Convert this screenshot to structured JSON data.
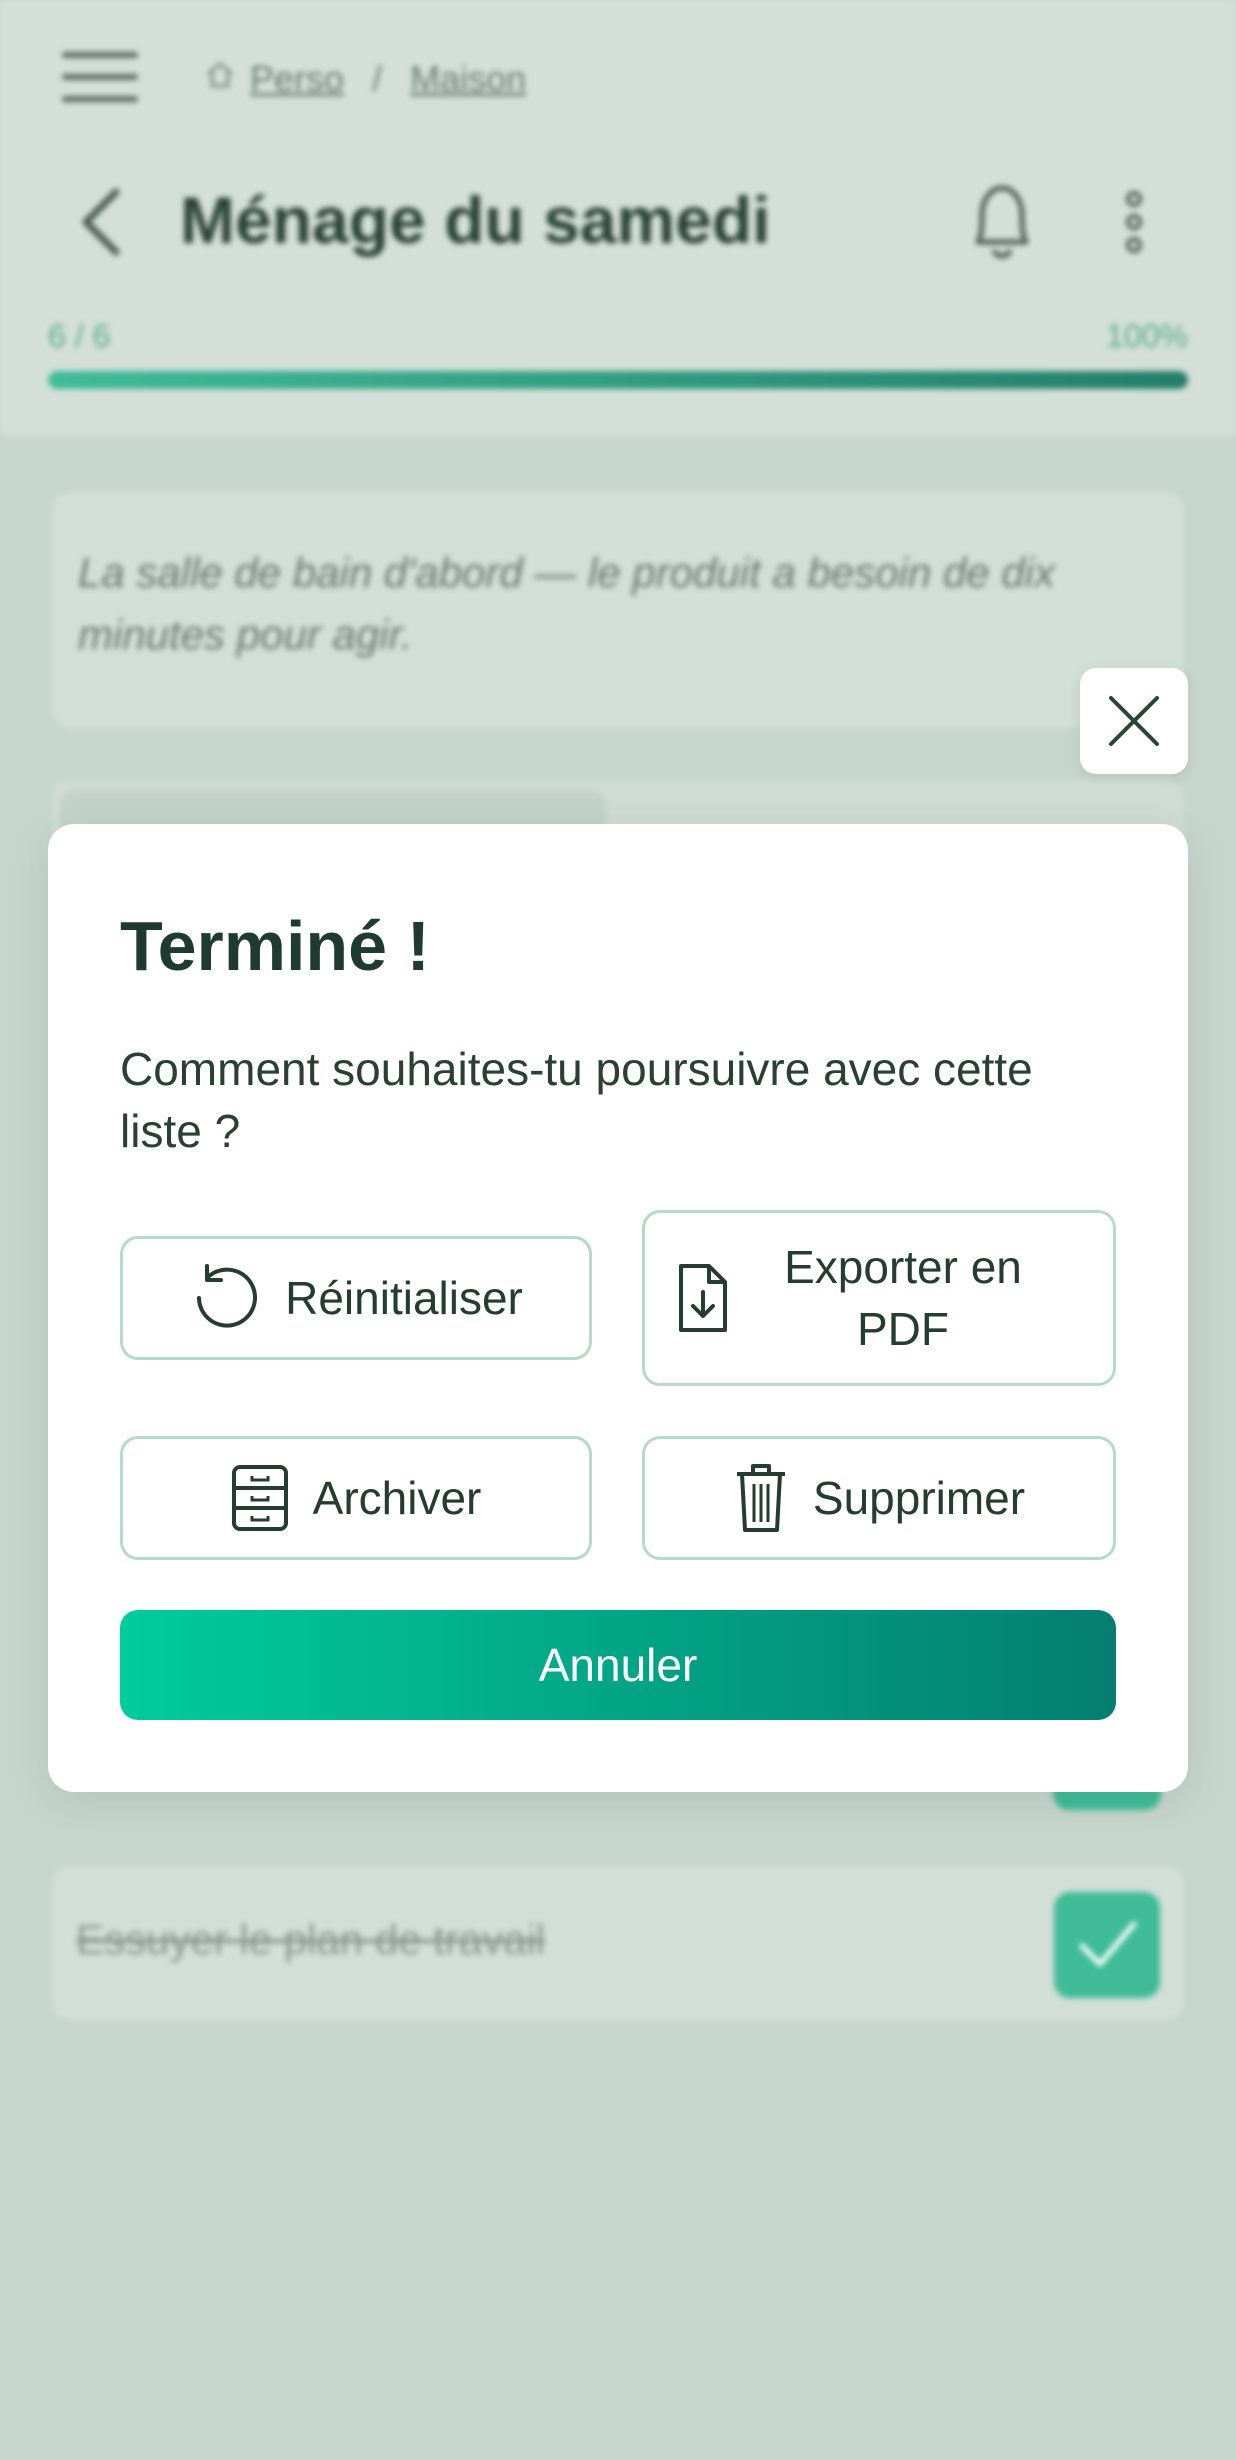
{
  "header": {
    "breadcrumb": [
      "Perso",
      "Maison"
    ],
    "breadcrumb_separator": "/",
    "title": "Ménage du samedi",
    "progress": {
      "label": "6 / 6",
      "percent_label": "100%",
      "fraction": 1.0
    }
  },
  "note": "La salle de bain d'abord — le produit a besoin de dix minutes pour agir.",
  "tasks": [
    {
      "label": "Essuyer le plan de travail",
      "done": true
    }
  ],
  "modal": {
    "title": "Terminé !",
    "subtitle": "Comment souhaites-tu poursuivre avec cette liste ?",
    "reset_label": "Réinitialiser",
    "export_label": "Exporter en PDF",
    "archive_label": "Archiver",
    "delete_label": "Supprimer",
    "cancel_label": "Annuler"
  },
  "icons": [
    "menu-icon",
    "home-icon",
    "back-arrow-icon",
    "bell-icon",
    "more-vertical-icon",
    "close-icon",
    "reset-icon",
    "file-download-icon",
    "archive-icon",
    "trash-icon",
    "check-icon"
  ],
  "colors": {
    "accent_start": "#00cc9c",
    "accent_end": "#047e71",
    "title": "#1f3a30"
  }
}
